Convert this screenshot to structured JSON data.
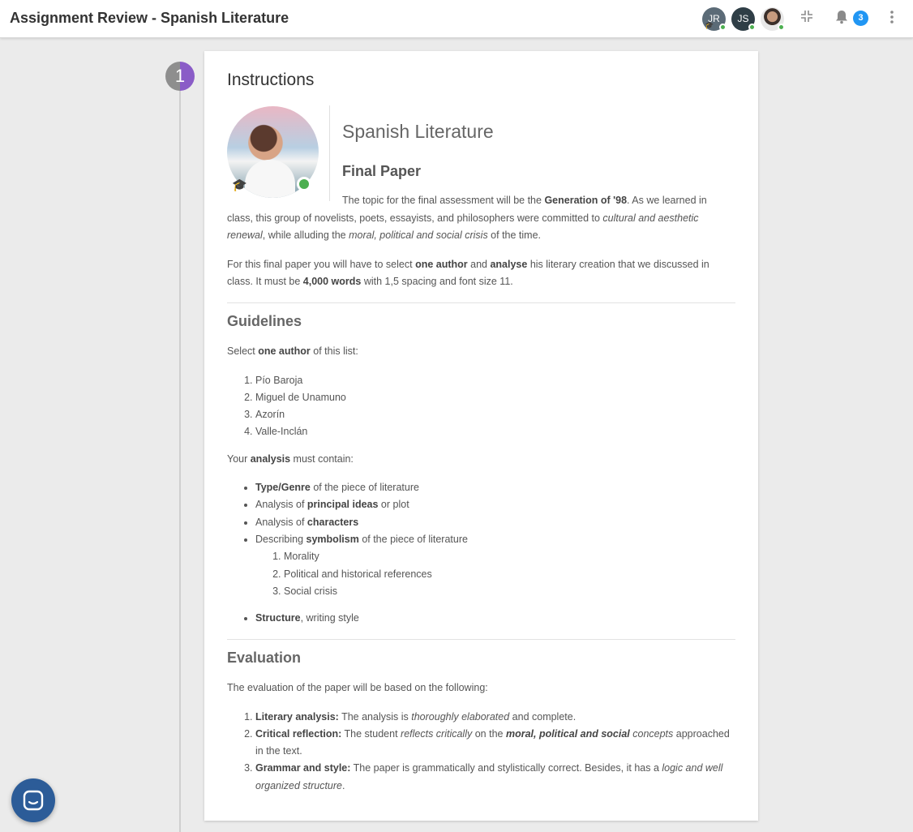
{
  "header": {
    "title": "Assignment Review - Spanish Literature",
    "avatars": [
      {
        "initials": "JR",
        "icon": "graduation-cap-icon",
        "status": "online"
      },
      {
        "initials": "JS",
        "status": "online"
      },
      {
        "initials": "",
        "status": "online"
      }
    ],
    "compress_icon": "⇲",
    "bell_icon": "🔔",
    "notification_count": "3",
    "more_icon": "⋮"
  },
  "step": {
    "number": "1"
  },
  "card": {
    "heading": "Instructions",
    "course_title": "Spanish Literature",
    "subtitle": "Final Paper",
    "intro": {
      "p1_a": "The topic for the final assessment will be the ",
      "p1_b": "Generation of '98",
      "p1_c": ". As we learned in class, this group of novelists, poets, essayists, and philosophers were committed to ",
      "p1_d": "cultural and aesthetic renewal",
      "p1_e": ", while alluding the ",
      "p1_f": "moral, political and social crisis",
      "p1_g": " of the time.",
      "p2_a": "For this final paper you will have to select ",
      "p2_b": "one author",
      "p2_c": " and ",
      "p2_d": "analyse",
      "p2_e": " his literary creation that we discussed in class. It must be ",
      "p2_f": "4,000 words",
      "p2_g": " with 1,5 spacing and font size 11."
    },
    "guidelines": {
      "heading": "Guidelines",
      "select_a": "Select ",
      "select_b": "one author",
      "select_c": " of this list:",
      "authors": [
        "Pío Baroja",
        "Miguel de Unamuno",
        "Azorín",
        "Valle-Inclán"
      ],
      "analysis_a": "Your ",
      "analysis_b": "analysis",
      "analysis_c": " must contain:",
      "items": [
        {
          "bold": "Type/Genre",
          "post": " of the piece of literature",
          "pre": ""
        },
        {
          "pre": "Analysis of ",
          "bold": "principal ideas",
          "post": " or plot"
        },
        {
          "pre": "Analysis of ",
          "bold": "characters",
          "post": ""
        },
        {
          "pre": "Describing ",
          "bold": "symbolism",
          "post": " of the piece of literature"
        },
        {
          "pre": "",
          "bold": "Structure",
          "post": ", writing style"
        }
      ],
      "symbolism_sub": [
        "Morality",
        "Political and historical references",
        "Social crisis"
      ]
    },
    "evaluation": {
      "heading": "Evaluation",
      "intro": "The evaluation of the paper will be based on the following:",
      "c1_bold": "Literary analysis:",
      "c1_a": " The analysis is ",
      "c1_i": "thoroughly elaborated",
      "c1_b": " and complete.",
      "c2_bold": "Critical reflection:",
      "c2_a": " The student ",
      "c2_i": "reflects critically",
      "c2_b": " on the ",
      "c2_bi": "moral, political and social",
      "c2_i2": " concepts",
      "c2_c": " approached in the text.",
      "c3_bold": "Grammar and style:",
      "c3_a": " The paper is grammatically and stylistically correct. Besides, it has a ",
      "c3_i": "logic and well organized structure",
      "c3_b": "."
    }
  },
  "chat_button": {
    "icon": "chat-bubble-icon"
  }
}
